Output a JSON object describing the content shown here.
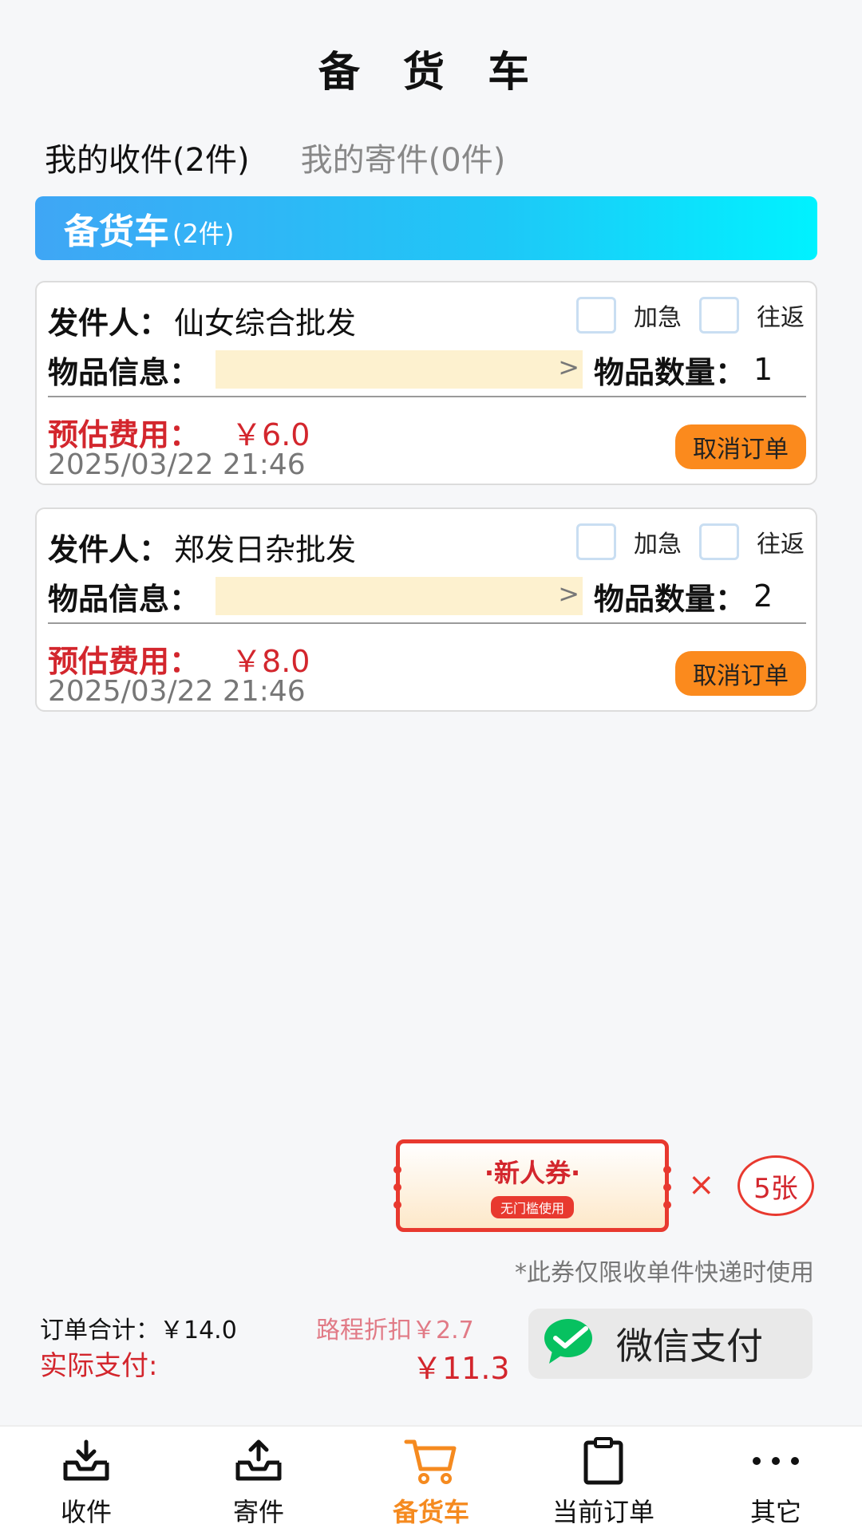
{
  "page": {
    "title": "备 货 车"
  },
  "tabs": [
    {
      "label": "我的收件(2件)"
    },
    {
      "label": "我的寄件(0件)"
    }
  ],
  "banner": {
    "title": "备货车",
    "count": "(2件)"
  },
  "orders": [
    {
      "sender_label": "发件人：",
      "sender_name": "仙女综合批发",
      "urgent_label": "加急",
      "roundtrip_label": "往返",
      "goods_label": "物品信息：",
      "goods_chevron": ">",
      "qty_label": "物品数量：",
      "qty_value": "1",
      "fee_label": "预估费用：",
      "fee_value": "￥6.0",
      "date": "2025/03/22 21:46",
      "cancel_label": "取消订单"
    },
    {
      "sender_label": "发件人：",
      "sender_name": "郑发日杂批发",
      "urgent_label": "加急",
      "roundtrip_label": "往返",
      "goods_label": "物品信息：",
      "goods_chevron": ">",
      "qty_label": "物品数量：",
      "qty_value": "2",
      "fee_label": "预估费用：",
      "fee_value": "￥8.0",
      "date": "2025/03/22 21:46",
      "cancel_label": "取消订单"
    }
  ],
  "coupon": {
    "title": "·新人券·",
    "subtitle": "无门槛使用",
    "times": "×",
    "count": "5张",
    "note": "*此券仅限收单件快递时使用"
  },
  "summary": {
    "total": "订单合计：￥14.0",
    "discount": "路程折扣￥2.7",
    "actual_label": "实际支付:",
    "actual_value": "￥11.3"
  },
  "pay": {
    "label": "微信支付",
    "icon": "wechat-icon"
  },
  "tabbar": [
    {
      "label": "收件",
      "icon": "inbox-download-icon"
    },
    {
      "label": "寄件",
      "icon": "inbox-upload-icon"
    },
    {
      "label": "备货车",
      "icon": "cart-icon"
    },
    {
      "label": "当前订单",
      "icon": "clipboard-icon"
    },
    {
      "label": "其它",
      "icon": "more-dots-icon"
    }
  ],
  "colors": {
    "accent_orange": "#fb8a1d",
    "price_red": "#d3262d",
    "banner_start": "#3fa6f5",
    "banner_end": "#00f2ff",
    "active_tab": "#f58a1f"
  }
}
